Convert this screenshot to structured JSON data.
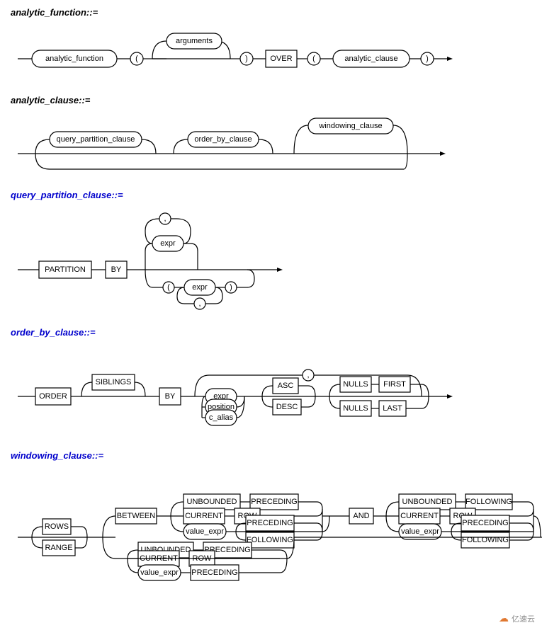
{
  "sections": [
    {
      "id": "analytic_function",
      "title": "analytic_function::=",
      "title_color": "black",
      "blue": false
    },
    {
      "id": "analytic_clause",
      "title": "analytic_clause::=",
      "title_color": "black",
      "blue": false
    },
    {
      "id": "query_partition_clause",
      "title": "query_partition_clause::=",
      "title_color": "blue",
      "blue": true
    },
    {
      "id": "order_by_clause",
      "title": "order_by_clause::=",
      "title_color": "blue",
      "blue": true
    },
    {
      "id": "windowing_clause",
      "title": "windowing_clause::=",
      "title_color": "blue",
      "blue": true
    }
  ],
  "watermark": {
    "icon": "☁",
    "text": "亿速云"
  }
}
